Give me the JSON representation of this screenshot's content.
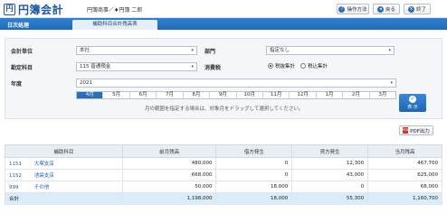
{
  "app": {
    "logo_mark": "円",
    "logo_text": "円簿会計",
    "user": "円簿商事／♦円簿 二郎"
  },
  "toolbar": {
    "help_label": "操作方法",
    "back_label": "戻る",
    "exit_label": "終了"
  },
  "nav": {
    "daily_label": "日次処理",
    "tab_label": "補助科目合計残高表"
  },
  "form": {
    "accounting_unit_label": "会計単位",
    "accounting_unit_value": "本社",
    "department_label": "部門",
    "department_value": "指定なし",
    "account_label": "勘定科目",
    "account_value": "115 普通預金",
    "tax_label": "消費税",
    "tax_options": [
      {
        "label": "税抜集計",
        "checked": true
      },
      {
        "label": "税込集計",
        "checked": false
      }
    ],
    "year_label": "年度",
    "year_value": "2021",
    "months": [
      "4月",
      "5月",
      "6月",
      "7月",
      "8月",
      "9月",
      "10月",
      "11月",
      "12月",
      "1月",
      "2月",
      "3月"
    ],
    "active_month": 0,
    "hint": "月の範囲を指定する場合は、対象月をドラッグして選択してください。",
    "show_label": "表 示",
    "pdf_label": "PDF出力"
  },
  "table": {
    "headers": [
      "補助科目",
      "前月残高",
      "借方発生",
      "貸方発生",
      "当月残高"
    ],
    "rows": [
      {
        "code": "1151",
        "name": "大塚支店",
        "prev": "480,000",
        "debit": "0",
        "credit": "12,300",
        "current": "467,700"
      },
      {
        "code": "1152",
        "name": "池袋支店",
        "prev": "668,000",
        "debit": "0",
        "credit": "43,000",
        "current": "625,000"
      },
      {
        "code": "999",
        "name": "その他",
        "prev": "50,000",
        "debit": "18,000",
        "credit": "0",
        "current": "68,000"
      }
    ],
    "total": {
      "label": "合計",
      "prev": "1,198,000",
      "debit": "18,000",
      "credit": "55,300",
      "current": "1,160,700"
    }
  }
}
